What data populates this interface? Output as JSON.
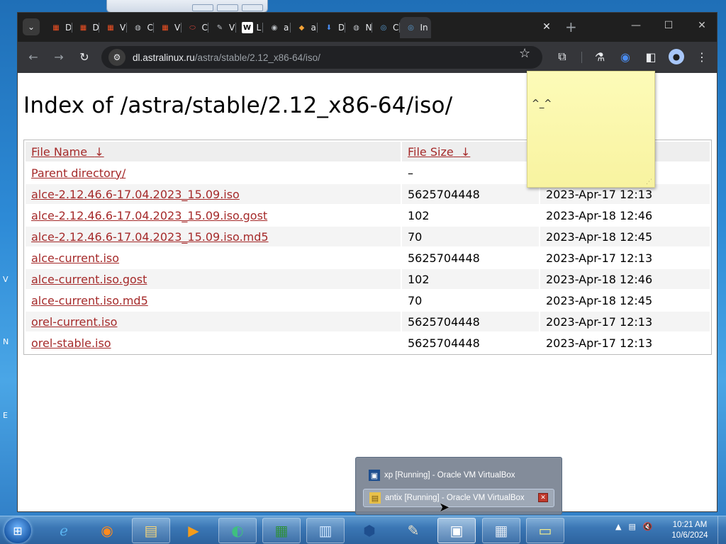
{
  "browser": {
    "tabs": [
      {
        "label": "D",
        "icon": "windows-icon",
        "color": "#f25022"
      },
      {
        "label": "D",
        "icon": "windows-icon",
        "color": "#f25022"
      },
      {
        "label": "V",
        "icon": "windows-icon",
        "color": "#f25022"
      },
      {
        "label": "C",
        "icon": "globe-icon",
        "color": "#bdc1c6"
      },
      {
        "label": "V",
        "icon": "windows-icon",
        "color": "#f25022"
      },
      {
        "label": "C",
        "icon": "oracle-icon",
        "color": "#e0453a"
      },
      {
        "label": "V",
        "icon": "pen-icon",
        "color": "#bdc1c6"
      },
      {
        "label": "L",
        "icon": "wikipedia-icon",
        "color": "#ffffff"
      },
      {
        "label": "a",
        "icon": "disc-icon",
        "color": "#bdc1c6"
      },
      {
        "label": "a",
        "icon": "diamond-icon",
        "color": "#f4a236"
      },
      {
        "label": "D",
        "icon": "download-icon",
        "color": "#4a8cf0"
      },
      {
        "label": "N",
        "icon": "globe-icon",
        "color": "#bdc1c6"
      },
      {
        "label": "C",
        "icon": "astra-icon",
        "color": "#5aa0d8"
      }
    ],
    "active_tab": {
      "label": "In",
      "icon": "astra-icon",
      "close": "✕"
    },
    "new_tab": "+",
    "url_host": "dl.astralinux.ru",
    "url_path": "/astra/stable/2.12_x86-64/iso/"
  },
  "page": {
    "title": "Index of /astra/stable/2.12_x86-64/iso/",
    "headers": {
      "name": "File Name",
      "name_sort": "↓",
      "size": "File Size",
      "size_sort": "↓"
    },
    "rows": [
      {
        "name": "Parent directory/",
        "size": "–",
        "date": ""
      },
      {
        "name": "alce-2.12.46.6-17.04.2023_15.09.iso",
        "size": "5625704448",
        "date": "2023-Apr-17 12:13"
      },
      {
        "name": "alce-2.12.46.6-17.04.2023_15.09.iso.gost",
        "size": "102",
        "date": "2023-Apr-18 12:46"
      },
      {
        "name": "alce-2.12.46.6-17.04.2023_15.09.iso.md5",
        "size": "70",
        "date": "2023-Apr-18 12:45"
      },
      {
        "name": "alce-current.iso",
        "size": "5625704448",
        "date": "2023-Apr-17 12:13"
      },
      {
        "name": "alce-current.iso.gost",
        "size": "102",
        "date": "2023-Apr-18 12:46"
      },
      {
        "name": "alce-current.iso.md5",
        "size": "70",
        "date": "2023-Apr-18 12:45"
      },
      {
        "name": "orel-current.iso",
        "size": "5625704448",
        "date": "2023-Apr-17 12:13"
      },
      {
        "name": "orel-stable.iso",
        "size": "5625704448",
        "date": "2023-Apr-17 12:13"
      }
    ]
  },
  "sticky_note": {
    "text": "^_^"
  },
  "taskbar_popup": {
    "items": [
      {
        "label": "xp [Running] - Oracle VM VirtualBox",
        "icon": "virtualbox-icon"
      },
      {
        "label": "antix [Running] - Oracle VM VirtualBox",
        "icon": "folder-icon"
      }
    ]
  },
  "taskbar": {
    "clock_time": "10:21 AM",
    "clock_date": "10/6/2024"
  }
}
